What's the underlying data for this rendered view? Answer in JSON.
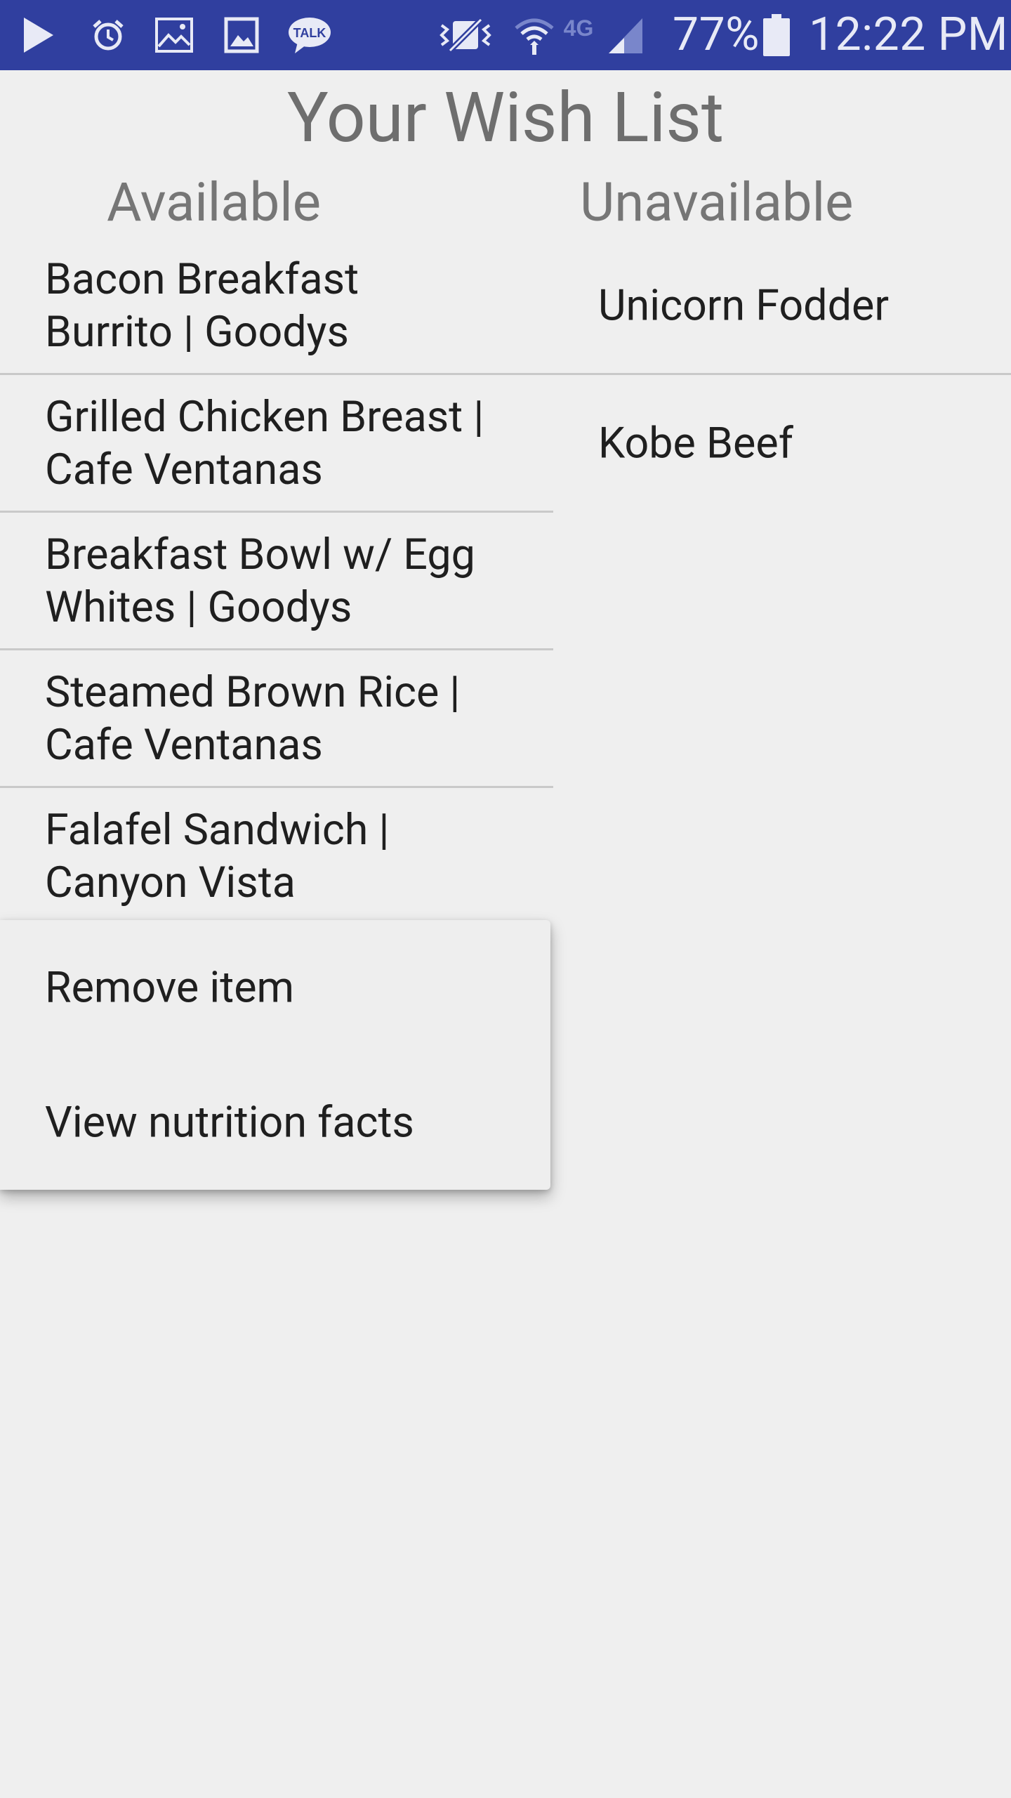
{
  "status_bar": {
    "icons": [
      "play-store-icon",
      "alarm-icon",
      "gallery-icon",
      "image-icon",
      "talk-icon",
      "vibrate-icon",
      "wifi-icon",
      "network-4g-icon",
      "signal-icon",
      "battery-icon"
    ],
    "talk_label": "TALK",
    "network_label": "4G",
    "battery_percent": "77%",
    "time": "12:22 PM"
  },
  "page": {
    "title": "Your Wish List"
  },
  "columns": {
    "available_header": "Available",
    "unavailable_header": "Unavailable"
  },
  "available_items": [
    {
      "line1": "Bacon Breakfast",
      "line2": "Burrito | Goodys"
    },
    {
      "line1": "Grilled Chicken Breast |",
      "line2": "Cafe Ventanas"
    },
    {
      "line1": "Breakfast Bowl w/ Egg",
      "line2": "Whites | Goodys"
    },
    {
      "line1": "Steamed Brown Rice |",
      "line2": "Cafe Ventanas"
    },
    {
      "line1": "Falafel Sandwich |",
      "line2": "Canyon Vista"
    }
  ],
  "unavailable_items": [
    {
      "label": "Unicorn Fodder"
    },
    {
      "label": "Kobe Beef"
    }
  ],
  "context_menu": {
    "items": [
      {
        "label": "Remove item"
      },
      {
        "label": "View nutrition facts"
      }
    ]
  },
  "colors": {
    "status_bar": "#303f9f",
    "background": "#efefef",
    "title_text": "#6e6e6e",
    "item_text": "#1f1f1f",
    "divider": "#c9c9c9"
  }
}
